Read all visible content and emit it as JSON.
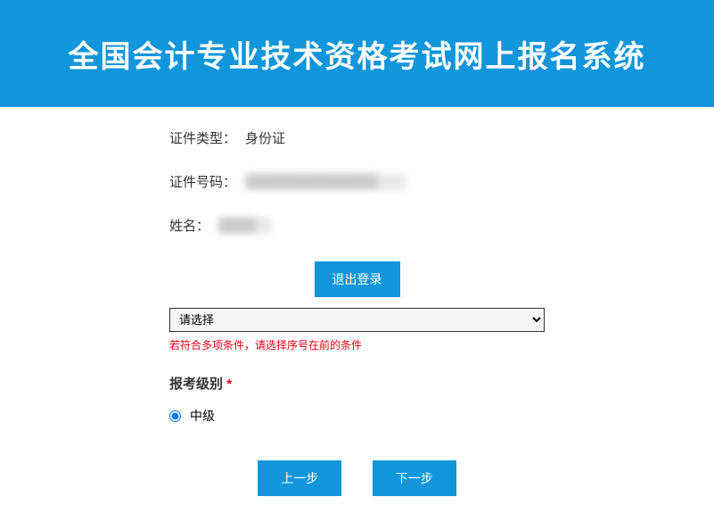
{
  "header": {
    "title": "全国会计专业技术资格考试网上报名系统"
  },
  "fields": {
    "idType": {
      "label": "证件类型：",
      "value": "身份证"
    },
    "idNumber": {
      "label": "证件号码：",
      "value": "██████████████"
    },
    "name": {
      "label": "姓名：",
      "value": "████"
    }
  },
  "buttons": {
    "logout": "退出登录",
    "prev": "上一步",
    "next": "下一步"
  },
  "select": {
    "placeholder": "请选择"
  },
  "hint": "若符合多项条件，请选择序号在前的条件",
  "examLevel": {
    "label": "报考级别",
    "star": "*",
    "option": "中级"
  }
}
